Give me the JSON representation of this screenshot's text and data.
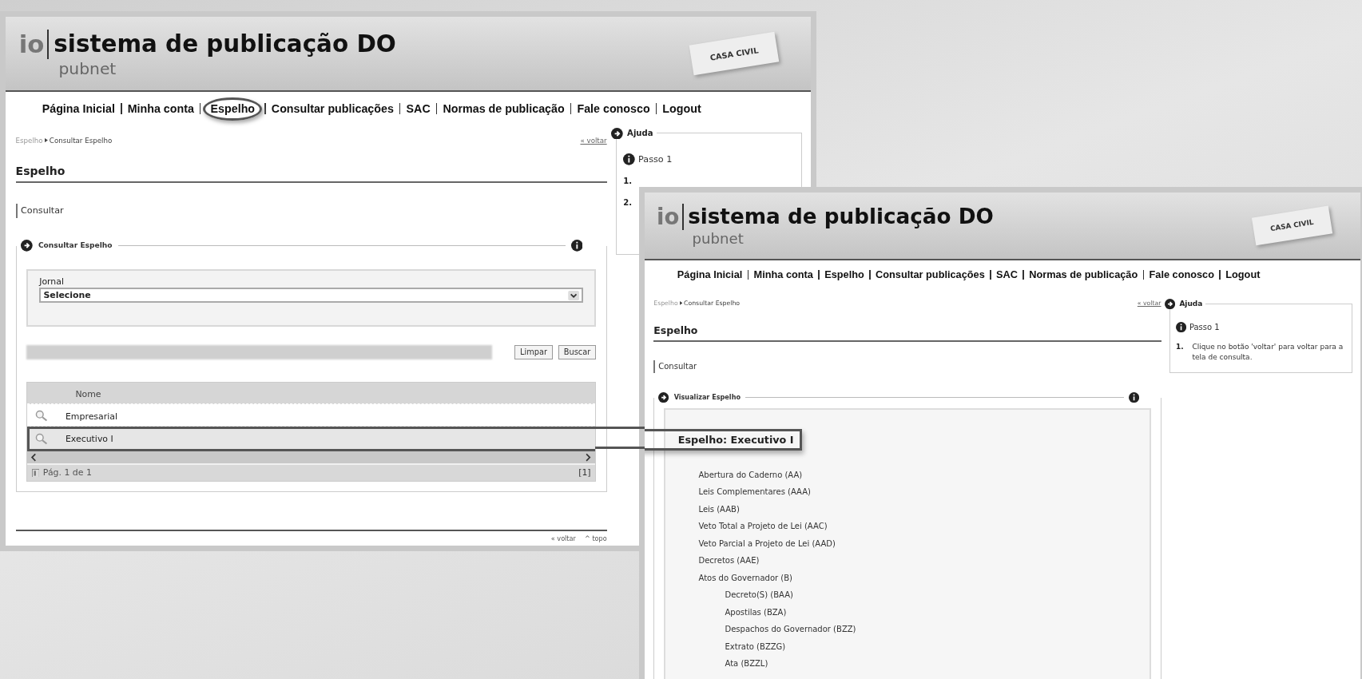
{
  "screens": [
    {
      "kind": "search",
      "header": {
        "logo": "io",
        "title": "sistema de publicação DO",
        "subtitle": "pubnet",
        "tag": "CASA CIVIL"
      },
      "nav": [
        {
          "label": "Página Inicial",
          "circled": false
        },
        {
          "label": "Minha conta",
          "circled": false
        },
        {
          "label": "Espelho",
          "circled": true
        },
        {
          "label": "Consultar publicações",
          "circled": false
        },
        {
          "label": "SAC",
          "circled": false
        },
        {
          "label": "Normas de publicação",
          "circled": false
        },
        {
          "label": "Fale conosco",
          "circled": false
        },
        {
          "label": "Logout",
          "circled": false
        }
      ],
      "breadcrumb": [
        "Espelho",
        "Consultar Espelho"
      ],
      "back_link": "« voltar",
      "page_title": "Espelho",
      "tab": "Consultar",
      "panel_title": "Consultar Espelho",
      "form": {
        "label": "Jornal",
        "value": "Selecione",
        "buttons": [
          "Limpar",
          "Buscar"
        ]
      },
      "table": {
        "columns": [
          "Nome"
        ],
        "rows": [
          {
            "name": "Empresarial",
            "selected": false
          },
          {
            "name": "Executivo I",
            "selected": true
          }
        ],
        "pager": "Pág. 1 de 1",
        "pages": "[1]"
      },
      "footer_links": [
        "« voltar",
        "^ topo"
      ],
      "help": {
        "title": "Ajuda",
        "step_title": "Passo 1",
        "steps": [
          {
            "number": "1."
          },
          {
            "number": "2."
          }
        ]
      }
    },
    {
      "kind": "view",
      "header": {
        "logo": "io",
        "title": "sistema de publicação DO",
        "subtitle": "pubnet",
        "tag": "CASA CIVIL"
      },
      "nav": [
        {
          "label": "Página Inicial",
          "circled": false
        },
        {
          "label": "Minha conta",
          "circled": false
        },
        {
          "label": "Espelho",
          "circled": false
        },
        {
          "label": "Consultar publicações",
          "circled": false
        },
        {
          "label": "SAC",
          "circled": false
        },
        {
          "label": "Normas de publicação",
          "circled": false
        },
        {
          "label": "Fale conosco",
          "circled": false
        },
        {
          "label": "Logout",
          "circled": false
        }
      ],
      "breadcrumb": [
        "Espelho",
        "Consultar Espelho"
      ],
      "back_link": "« voltar",
      "page_title": "Espelho",
      "tab": "Consultar",
      "panel_title": "Visualizar Espelho",
      "heading": "Espelho: Executivo I",
      "sections": [
        {
          "label": "Abertura do Caderno (AA)"
        },
        {
          "label": "Leis Complementares (AAA)"
        },
        {
          "label": "Leis (AAB)"
        },
        {
          "label": "Veto Total a Projeto de Lei (AAC)"
        },
        {
          "label": "Veto Parcial a Projeto de Lei (AAD)"
        },
        {
          "label": "Decretos (AAE)"
        },
        {
          "label": "Atos do Governador (B)",
          "children": [
            {
              "label": "Decreto(S) (BAA)"
            },
            {
              "label": "Apostilas (BZA)"
            },
            {
              "label": "Despachos do Governador (BZZ)"
            },
            {
              "label": "Extrato (BZZG)"
            },
            {
              "label": "Ata (BZZL)"
            }
          ]
        }
      ],
      "help": {
        "title": "Ajuda",
        "step_title": "Passo 1",
        "steps": [
          {
            "number": "1.",
            "text": "Clique no botão 'voltar' para voltar para a tela de consulta."
          }
        ]
      }
    }
  ]
}
